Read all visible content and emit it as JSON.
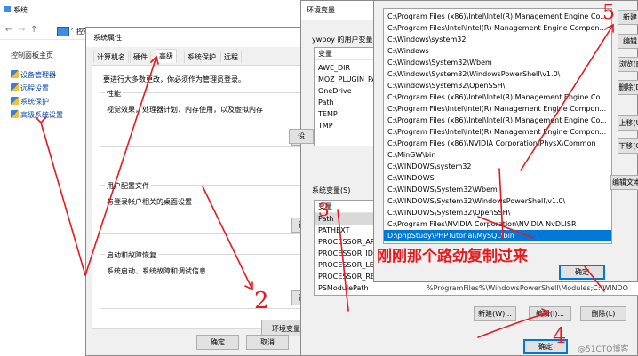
{
  "control_panel": {
    "window_title": "系统",
    "address_text": "控制",
    "sidebar_title": "控制面板主页",
    "sidebar_items": [
      {
        "label": "设备管理器"
      },
      {
        "label": "远程设置"
      },
      {
        "label": "系统保护"
      },
      {
        "label": "高级系统设置"
      }
    ]
  },
  "system_properties": {
    "title": "系统属性",
    "tabs": [
      "计算机名",
      "硬件",
      "高级",
      "系统保护",
      "远程"
    ],
    "admin_note": "要进行大多数更改，你必须作为管理员登录。",
    "performance": {
      "heading": "性能",
      "desc": "视觉效果，处理器计划，内存使用，以及虚拟内存",
      "button": "设"
    },
    "user_profiles": {
      "heading": "用户配置文件",
      "desc": "与登录帐户相关的桌面设置",
      "button": "设"
    },
    "startup_recovery": {
      "heading": "启动和故障恢复",
      "desc": "系统启动、系统故障和调试信息",
      "button": "设"
    },
    "env_button": "环境变量",
    "ok": "确定",
    "cancel": "取消"
  },
  "env_vars": {
    "title": "环境变量",
    "user_group": "ywboy 的用户变量(U)",
    "user_header": "变量",
    "user_vars": [
      "AWE_DIR",
      "MOZ_PLUGIN_PA",
      "OneDrive",
      "Path",
      "TEMP",
      "TMP"
    ],
    "user_button": "设",
    "system_group": "系统变量(S)",
    "system_header": "变量",
    "system_vars": [
      "Path",
      "PATHEXT",
      "PROCESSOR_ARC",
      "PROCESSOR_IDE",
      "PROCESSOR_LEV",
      "PROCESSOR_REV",
      "PSModulePath"
    ],
    "system_value_fragment": "%ProgramFiles%\\WindowsPowerShell\\Modules;C:\\WINDO",
    "new_button": "新建(W)...",
    "edit_button": "编辑(I)...",
    "delete_button": "删除(L)",
    "ok": "确定"
  },
  "edit_env": {
    "paths": [
      "C:\\Program Files (x86)\\Intel\\Intel(R) Management Engine Co...",
      "C:\\Program Files\\Intel\\Intel(R) Management Engine Compon...",
      "C:\\Windows\\system32",
      "C:\\Windows",
      "C:\\Windows\\System32\\Wbem",
      "C:\\Windows\\System32\\WindowsPowerShell\\v1.0\\",
      "C:\\Windows\\System32\\OpenSSH\\",
      "C:\\Program Files (x86)\\Intel\\Intel(R) Management Engine Co...",
      "C:\\Program Files\\Intel\\Intel(R) Management Engine Compon...",
      "C:\\Program Files (x86)\\Intel\\Intel(R) Management Engine Co...",
      "C:\\Program Files\\Intel\\Intel(R) Management Engine Compon...",
      "C:\\Program Files (x86)\\NVIDIA Corporation\\PhysX\\Common",
      "C:\\MinGW\\bin",
      "C:\\WINDOWS\\system32",
      "C:\\WINDOWS",
      "C:\\WINDOWS\\System32\\Wbem",
      "C:\\WINDOWS\\System32\\WindowsPowerShell\\v1.0\\",
      "C:\\WINDOWS\\System32\\OpenSSH\\",
      "C:\\Program Files\\NVIDIA Corporation\\NVIDIA NvDLISR",
      "D:\\phpStudy\\PHPTutorial\\MySQL\\bin"
    ],
    "selected_index": 19,
    "buttons": [
      "新建",
      "编辑",
      "浏览(B",
      "删除(D",
      "上移(U",
      "下移(O",
      "编辑文本"
    ],
    "ok": "确定"
  },
  "annotations": {
    "note": "刚刚那个路劲复制过来",
    "step2": "2",
    "step3": "3",
    "step4": "4",
    "step5": "5"
  },
  "watermark": "@51CTO博客"
}
